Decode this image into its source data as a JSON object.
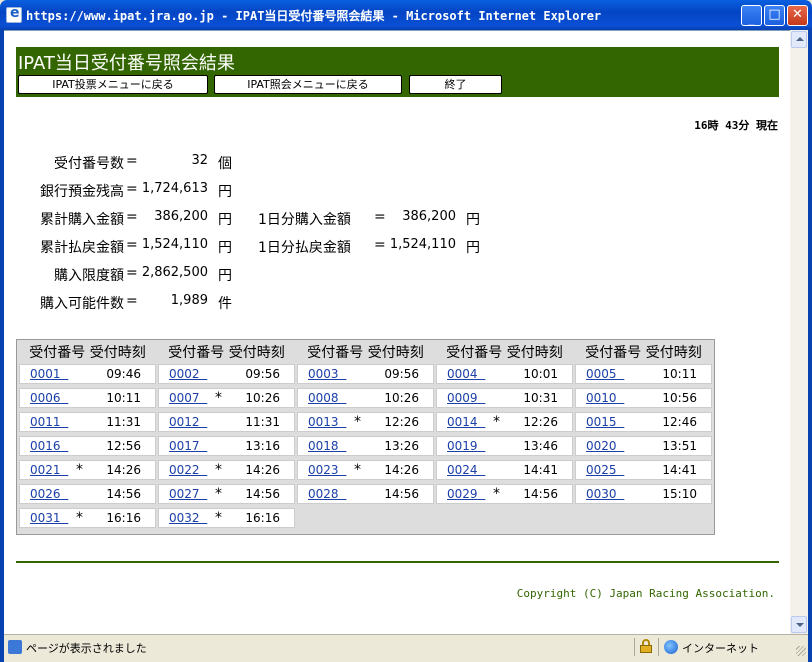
{
  "window": {
    "title": "https://www.ipat.jra.go.jp - IPAT当日受付番号照会結果 - Microsoft Internet Explorer"
  },
  "page": {
    "title": "IPAT当日受付番号照会結果",
    "nav": [
      {
        "label": "IPAT投票メニューに戻る"
      },
      {
        "label": "IPAT照会メニューに戻る"
      },
      {
        "label": "終了"
      }
    ],
    "timestamp": "16時 43分 現在"
  },
  "summary": {
    "receipt_count": {
      "label": "受付番号数",
      "eq": "=",
      "value": "32",
      "unit": "個"
    },
    "bank_balance": {
      "label": "銀行預金残高",
      "eq": "=",
      "value": "1,724,613",
      "unit": "円"
    },
    "total_purchase": {
      "label": "累計購入金額",
      "eq": "=",
      "value": "386,200",
      "unit": "円"
    },
    "day_purchase": {
      "label": "1日分購入金額",
      "eq": "=",
      "value": "386,200",
      "unit": "円"
    },
    "total_payout": {
      "label": "累計払戻金額",
      "eq": "=",
      "value": "1,524,110",
      "unit": "円"
    },
    "day_payout": {
      "label": "1日分払戻金額",
      "eq": "=",
      "value": "1,524,110",
      "unit": "円"
    },
    "purchase_limit": {
      "label": "購入限度額",
      "eq": "=",
      "value": "2,862,500",
      "unit": "円"
    },
    "purchasable_count": {
      "label": "購入可能件数",
      "eq": "=",
      "value": "1,989",
      "unit": "件"
    }
  },
  "receipts": {
    "header_number": "受付番号",
    "header_time": "受付時刻",
    "rows": [
      {
        "num": "0001",
        "mark": "",
        "time": "09:46"
      },
      {
        "num": "0002",
        "mark": "",
        "time": "09:56"
      },
      {
        "num": "0003",
        "mark": "",
        "time": "09:56"
      },
      {
        "num": "0004",
        "mark": "",
        "time": "10:01"
      },
      {
        "num": "0005",
        "mark": "",
        "time": "10:11"
      },
      {
        "num": "0006",
        "mark": "",
        "time": "10:11"
      },
      {
        "num": "0007",
        "mark": "*",
        "time": "10:26"
      },
      {
        "num": "0008",
        "mark": "",
        "time": "10:26"
      },
      {
        "num": "0009",
        "mark": "",
        "time": "10:31"
      },
      {
        "num": "0010",
        "mark": "",
        "time": "10:56"
      },
      {
        "num": "0011",
        "mark": "",
        "time": "11:31"
      },
      {
        "num": "0012",
        "mark": "",
        "time": "11:31"
      },
      {
        "num": "0013",
        "mark": "*",
        "time": "12:26"
      },
      {
        "num": "0014",
        "mark": "*",
        "time": "12:26"
      },
      {
        "num": "0015",
        "mark": "",
        "time": "12:46"
      },
      {
        "num": "0016",
        "mark": "",
        "time": "12:56"
      },
      {
        "num": "0017",
        "mark": "",
        "time": "13:16"
      },
      {
        "num": "0018",
        "mark": "",
        "time": "13:26"
      },
      {
        "num": "0019",
        "mark": "",
        "time": "13:46"
      },
      {
        "num": "0020",
        "mark": "",
        "time": "13:51"
      },
      {
        "num": "0021",
        "mark": "*",
        "time": "14:26"
      },
      {
        "num": "0022",
        "mark": "*",
        "time": "14:26"
      },
      {
        "num": "0023",
        "mark": "*",
        "time": "14:26"
      },
      {
        "num": "0024",
        "mark": "",
        "time": "14:41"
      },
      {
        "num": "0025",
        "mark": "",
        "time": "14:41"
      },
      {
        "num": "0026",
        "mark": "",
        "time": "14:56"
      },
      {
        "num": "0027",
        "mark": "*",
        "time": "14:56"
      },
      {
        "num": "0028",
        "mark": "",
        "time": "14:56"
      },
      {
        "num": "0029",
        "mark": "*",
        "time": "14:56"
      },
      {
        "num": "0030",
        "mark": "",
        "time": "15:10"
      },
      {
        "num": "0031",
        "mark": "*",
        "time": "16:16"
      },
      {
        "num": "0032",
        "mark": "*",
        "time": "16:16"
      }
    ]
  },
  "footer": {
    "copyright": "Copyright (C) Japan Racing Association."
  },
  "statusbar": {
    "text": "ページが表示されました",
    "zone": "インターネット"
  },
  "icons": {
    "title_icon": "ie-page-icon",
    "status_icon": "page-done-icon",
    "lock": "lock-icon",
    "zone": "globe-icon"
  },
  "colors": {
    "header_green": "#336600",
    "titlebar_blue": "#0a4fd4",
    "link_blue": "#1a3fa8"
  }
}
